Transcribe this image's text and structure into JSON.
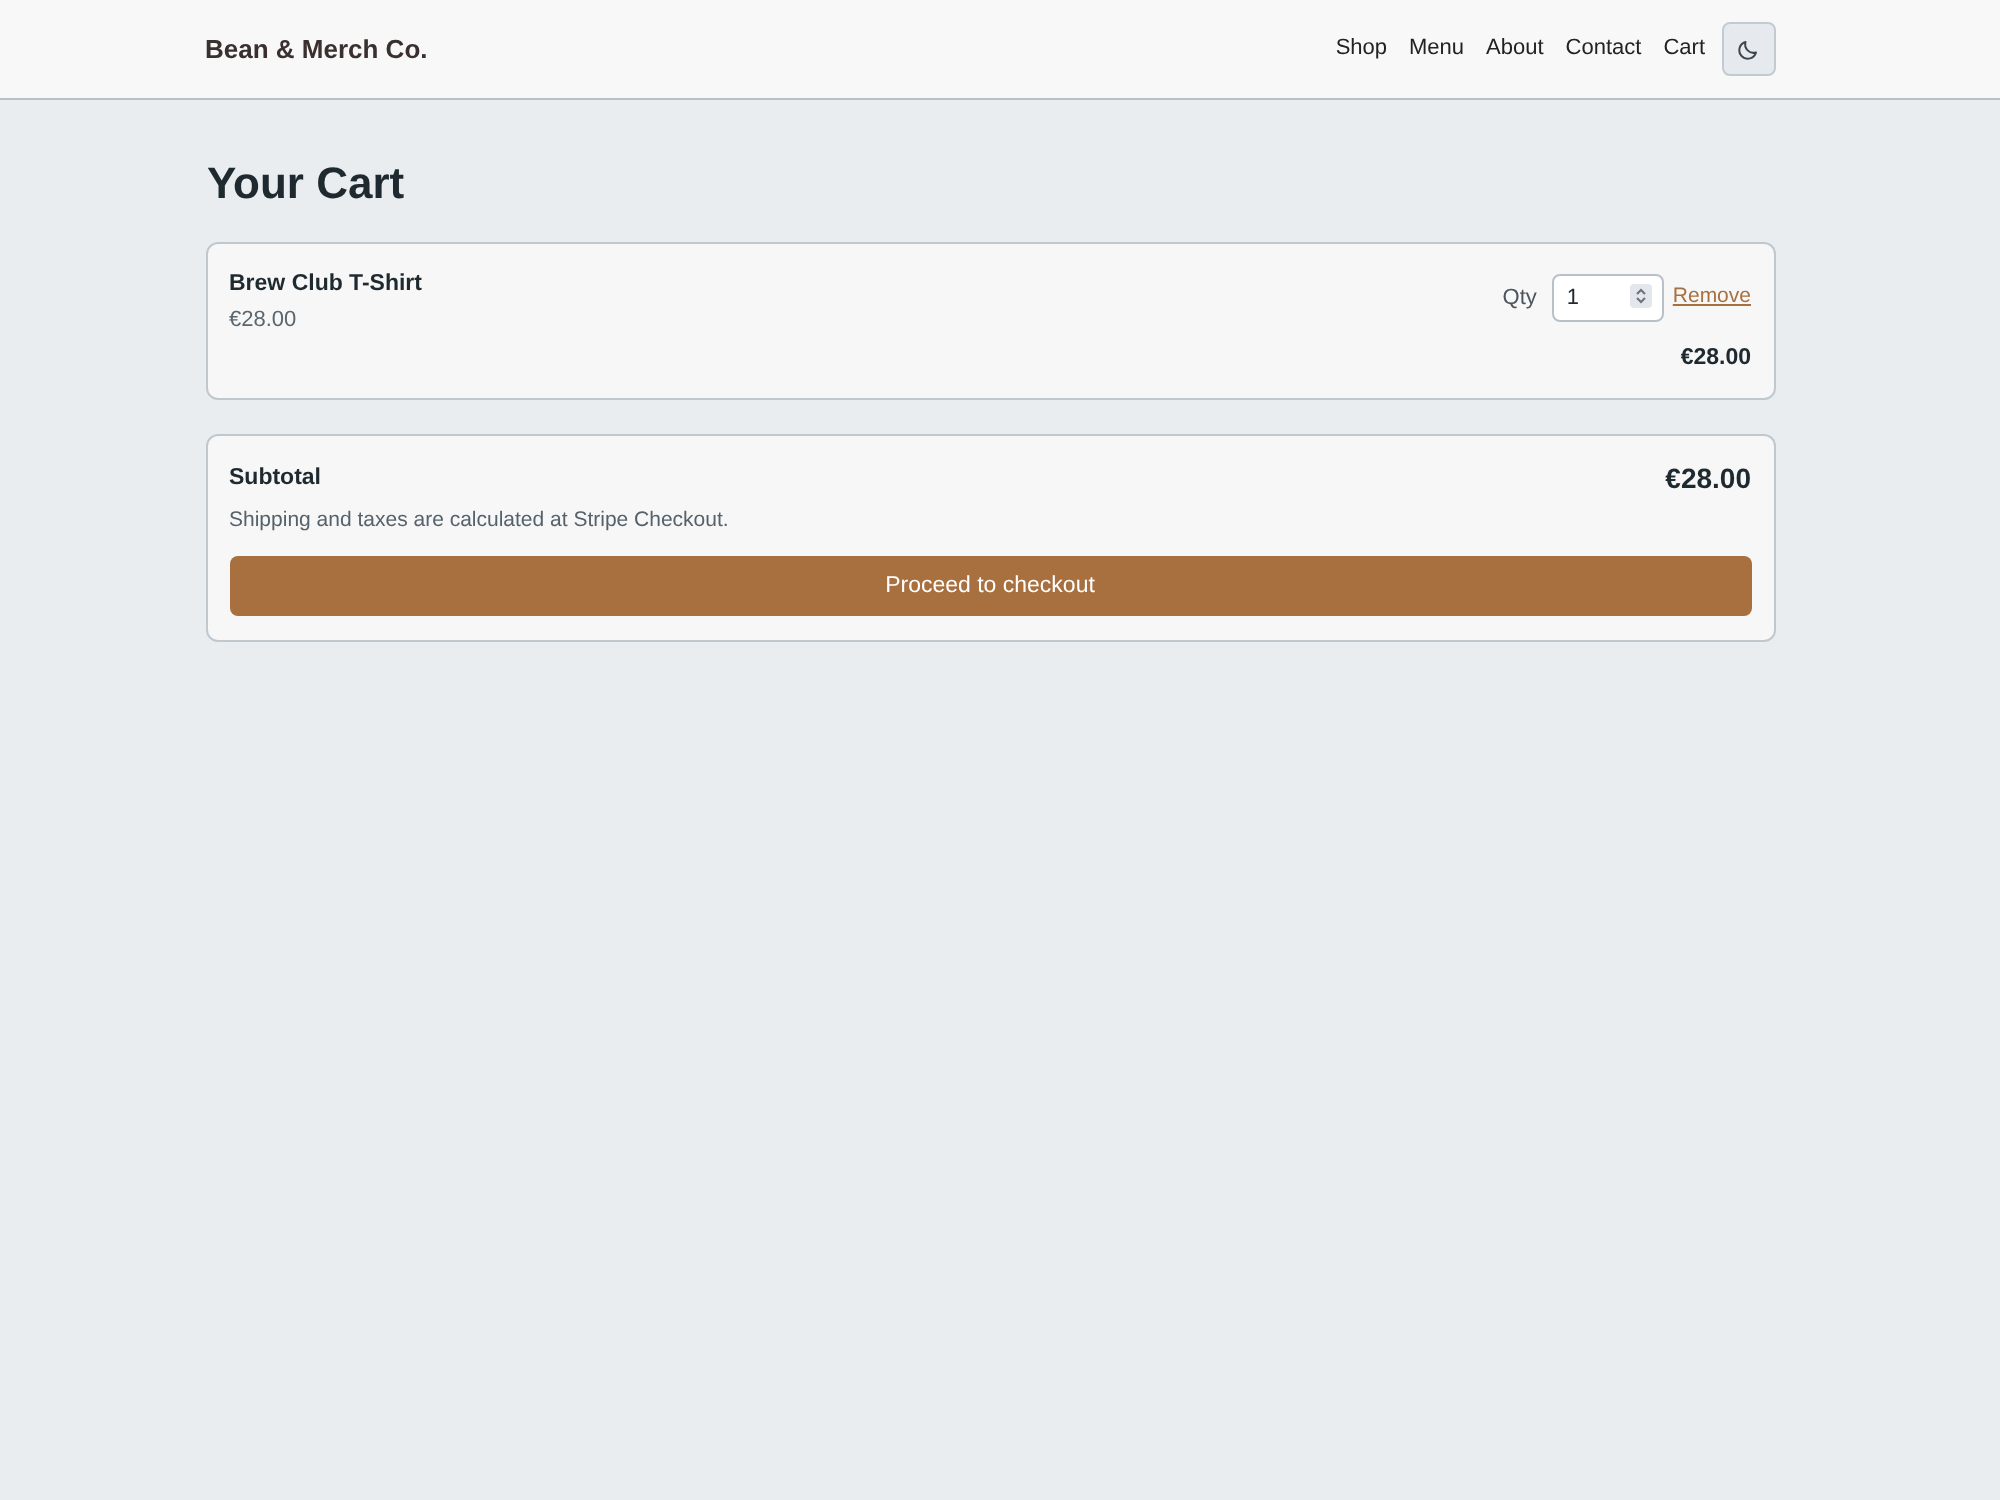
{
  "navbar": {
    "brand": "Bean & Merch Co.",
    "links": [
      {
        "label": "Shop"
      },
      {
        "label": "Menu"
      },
      {
        "label": "About"
      },
      {
        "label": "Contact"
      },
      {
        "label": "Cart"
      }
    ]
  },
  "page_title": "Your Cart",
  "cart_items": [
    {
      "name": "Brew Club T-Shirt",
      "unit_price": "€28.00",
      "qty_label": "Qty",
      "quantity": "1",
      "remove_label": "Remove",
      "line_total": "€28.00"
    }
  ],
  "summary": {
    "label": "Subtotal",
    "amount": "€28.00",
    "note": "Shipping and taxes are calculated at Stripe Checkout.",
    "checkout_button": "Proceed to checkout"
  }
}
